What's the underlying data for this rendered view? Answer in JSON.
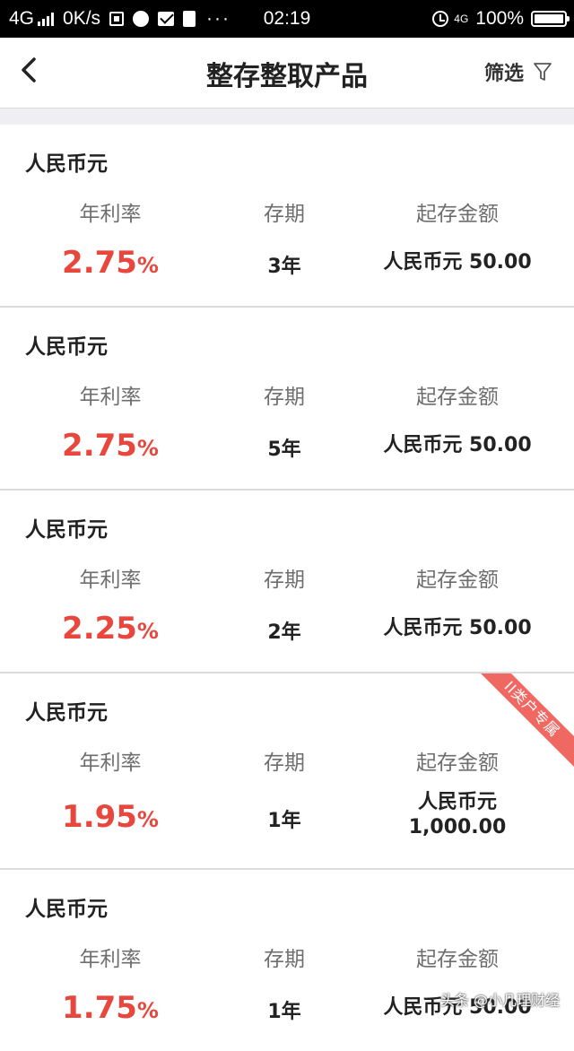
{
  "status_bar": {
    "network": "4G",
    "speed": "0K/s",
    "time": "02:19",
    "net_right": "4G",
    "battery": "100%",
    "icons": [
      "signal-icon",
      "app-icon",
      "round-app-icon",
      "mail-icon",
      "clipboard-icon",
      "more-dots-icon",
      "alarm-icon",
      "battery-icon"
    ],
    "more": "···"
  },
  "header": {
    "title": "整存整取产品",
    "filter_label": "筛选",
    "back_icon": "chevron-left-icon",
    "filter_icon": "funnel-icon"
  },
  "labels": {
    "rate": "年利率",
    "term": "存期",
    "min_amount": "起存金额"
  },
  "products": [
    {
      "currency": "人民币元",
      "rate": "2.75",
      "rate_unit": "%",
      "term": "3年",
      "min_amount": "人民币元 50.00"
    },
    {
      "currency": "人民币元",
      "rate": "2.75",
      "rate_unit": "%",
      "term": "5年",
      "min_amount": "人民币元 50.00"
    },
    {
      "currency": "人民币元",
      "rate": "2.25",
      "rate_unit": "%",
      "term": "2年",
      "min_amount": "人民币元 50.00"
    },
    {
      "currency": "人民币元",
      "rate": "1.95",
      "rate_unit": "%",
      "term": "1年",
      "min_amount_line1": "人民币元",
      "min_amount_line2": "1,000.00",
      "ribbon": "II类户专属"
    },
    {
      "currency": "人民币元",
      "rate": "1.75",
      "rate_unit": "%",
      "term": "1年",
      "min_amount": "人民币元 50.00"
    }
  ],
  "watermark": "头条 @小几理财经",
  "colors": {
    "accent_red": "#e8473d",
    "ribbon": "#f06862",
    "divider": "#dcdcdc",
    "strip": "#eeeef3"
  }
}
